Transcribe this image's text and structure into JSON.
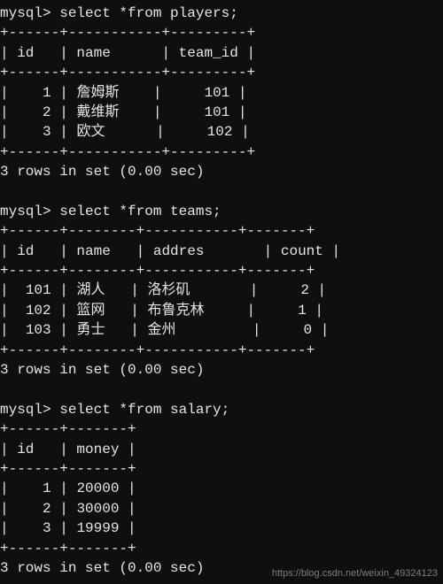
{
  "prompt": "mysql>",
  "queries": {
    "players": "select *from players;",
    "teams": "select *from teams;",
    "salary": "select *from salary;"
  },
  "tables": {
    "players": {
      "headers": [
        "id",
        "name",
        "team_id"
      ],
      "rows": [
        {
          "id": "1",
          "name": "詹姆斯",
          "team_id": "101"
        },
        {
          "id": "2",
          "name": "戴维斯",
          "team_id": "101"
        },
        {
          "id": "3",
          "name": "欧文",
          "team_id": "102"
        }
      ]
    },
    "teams": {
      "headers": [
        "id",
        "name",
        "addres",
        "count"
      ],
      "rows": [
        {
          "id": "101",
          "name": "湖人",
          "addres": "洛杉矶",
          "count": "2"
        },
        {
          "id": "102",
          "name": "篮网",
          "addres": "布鲁克林",
          "count": "1"
        },
        {
          "id": "103",
          "name": "勇士",
          "addres": "金州",
          "count": "0"
        }
      ]
    },
    "salary": {
      "headers": [
        "id",
        "money"
      ],
      "rows": [
        {
          "id": "1",
          "money": "20000"
        },
        {
          "id": "2",
          "money": "30000"
        },
        {
          "id": "3",
          "money": "19999"
        }
      ]
    }
  },
  "status": "3 rows in set (0.00 sec)",
  "watermark": "https://blog.csdn.net/weixin_49324123"
}
